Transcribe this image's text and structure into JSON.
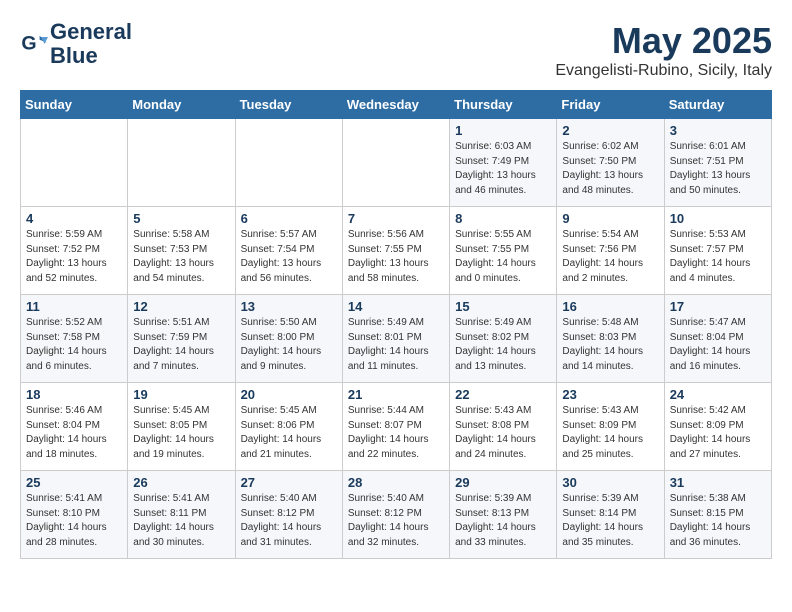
{
  "header": {
    "logo_line1": "General",
    "logo_line2": "Blue",
    "month": "May 2025",
    "location": "Evangelisti-Rubino, Sicily, Italy"
  },
  "weekdays": [
    "Sunday",
    "Monday",
    "Tuesday",
    "Wednesday",
    "Thursday",
    "Friday",
    "Saturday"
  ],
  "weeks": [
    [
      {
        "day": "",
        "info": ""
      },
      {
        "day": "",
        "info": ""
      },
      {
        "day": "",
        "info": ""
      },
      {
        "day": "",
        "info": ""
      },
      {
        "day": "1",
        "info": "Sunrise: 6:03 AM\nSunset: 7:49 PM\nDaylight: 13 hours\nand 46 minutes."
      },
      {
        "day": "2",
        "info": "Sunrise: 6:02 AM\nSunset: 7:50 PM\nDaylight: 13 hours\nand 48 minutes."
      },
      {
        "day": "3",
        "info": "Sunrise: 6:01 AM\nSunset: 7:51 PM\nDaylight: 13 hours\nand 50 minutes."
      }
    ],
    [
      {
        "day": "4",
        "info": "Sunrise: 5:59 AM\nSunset: 7:52 PM\nDaylight: 13 hours\nand 52 minutes."
      },
      {
        "day": "5",
        "info": "Sunrise: 5:58 AM\nSunset: 7:53 PM\nDaylight: 13 hours\nand 54 minutes."
      },
      {
        "day": "6",
        "info": "Sunrise: 5:57 AM\nSunset: 7:54 PM\nDaylight: 13 hours\nand 56 minutes."
      },
      {
        "day": "7",
        "info": "Sunrise: 5:56 AM\nSunset: 7:55 PM\nDaylight: 13 hours\nand 58 minutes."
      },
      {
        "day": "8",
        "info": "Sunrise: 5:55 AM\nSunset: 7:55 PM\nDaylight: 14 hours\nand 0 minutes."
      },
      {
        "day": "9",
        "info": "Sunrise: 5:54 AM\nSunset: 7:56 PM\nDaylight: 14 hours\nand 2 minutes."
      },
      {
        "day": "10",
        "info": "Sunrise: 5:53 AM\nSunset: 7:57 PM\nDaylight: 14 hours\nand 4 minutes."
      }
    ],
    [
      {
        "day": "11",
        "info": "Sunrise: 5:52 AM\nSunset: 7:58 PM\nDaylight: 14 hours\nand 6 minutes."
      },
      {
        "day": "12",
        "info": "Sunrise: 5:51 AM\nSunset: 7:59 PM\nDaylight: 14 hours\nand 7 minutes."
      },
      {
        "day": "13",
        "info": "Sunrise: 5:50 AM\nSunset: 8:00 PM\nDaylight: 14 hours\nand 9 minutes."
      },
      {
        "day": "14",
        "info": "Sunrise: 5:49 AM\nSunset: 8:01 PM\nDaylight: 14 hours\nand 11 minutes."
      },
      {
        "day": "15",
        "info": "Sunrise: 5:49 AM\nSunset: 8:02 PM\nDaylight: 14 hours\nand 13 minutes."
      },
      {
        "day": "16",
        "info": "Sunrise: 5:48 AM\nSunset: 8:03 PM\nDaylight: 14 hours\nand 14 minutes."
      },
      {
        "day": "17",
        "info": "Sunrise: 5:47 AM\nSunset: 8:04 PM\nDaylight: 14 hours\nand 16 minutes."
      }
    ],
    [
      {
        "day": "18",
        "info": "Sunrise: 5:46 AM\nSunset: 8:04 PM\nDaylight: 14 hours\nand 18 minutes."
      },
      {
        "day": "19",
        "info": "Sunrise: 5:45 AM\nSunset: 8:05 PM\nDaylight: 14 hours\nand 19 minutes."
      },
      {
        "day": "20",
        "info": "Sunrise: 5:45 AM\nSunset: 8:06 PM\nDaylight: 14 hours\nand 21 minutes."
      },
      {
        "day": "21",
        "info": "Sunrise: 5:44 AM\nSunset: 8:07 PM\nDaylight: 14 hours\nand 22 minutes."
      },
      {
        "day": "22",
        "info": "Sunrise: 5:43 AM\nSunset: 8:08 PM\nDaylight: 14 hours\nand 24 minutes."
      },
      {
        "day": "23",
        "info": "Sunrise: 5:43 AM\nSunset: 8:09 PM\nDaylight: 14 hours\nand 25 minutes."
      },
      {
        "day": "24",
        "info": "Sunrise: 5:42 AM\nSunset: 8:09 PM\nDaylight: 14 hours\nand 27 minutes."
      }
    ],
    [
      {
        "day": "25",
        "info": "Sunrise: 5:41 AM\nSunset: 8:10 PM\nDaylight: 14 hours\nand 28 minutes."
      },
      {
        "day": "26",
        "info": "Sunrise: 5:41 AM\nSunset: 8:11 PM\nDaylight: 14 hours\nand 30 minutes."
      },
      {
        "day": "27",
        "info": "Sunrise: 5:40 AM\nSunset: 8:12 PM\nDaylight: 14 hours\nand 31 minutes."
      },
      {
        "day": "28",
        "info": "Sunrise: 5:40 AM\nSunset: 8:12 PM\nDaylight: 14 hours\nand 32 minutes."
      },
      {
        "day": "29",
        "info": "Sunrise: 5:39 AM\nSunset: 8:13 PM\nDaylight: 14 hours\nand 33 minutes."
      },
      {
        "day": "30",
        "info": "Sunrise: 5:39 AM\nSunset: 8:14 PM\nDaylight: 14 hours\nand 35 minutes."
      },
      {
        "day": "31",
        "info": "Sunrise: 5:38 AM\nSunset: 8:15 PM\nDaylight: 14 hours\nand 36 minutes."
      }
    ]
  ]
}
